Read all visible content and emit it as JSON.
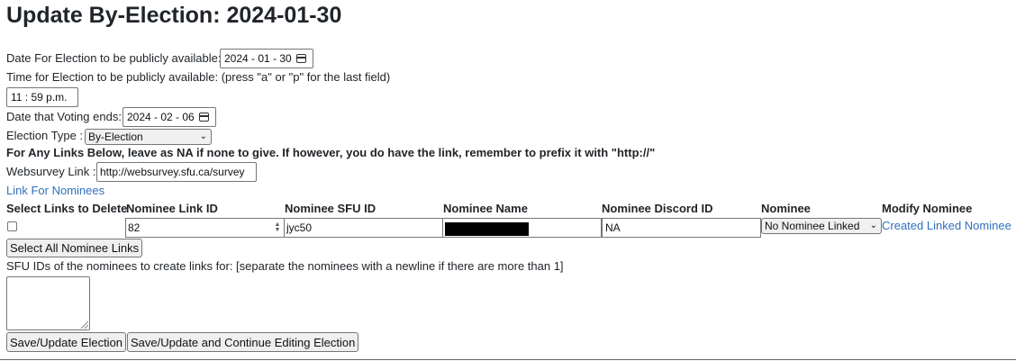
{
  "page_title": "Update By-Election: 2024-01-30",
  "publish_date": {
    "label": "Date For Election to be publicly available:",
    "value": "2024 - 01 - 30"
  },
  "publish_time": {
    "label": "Time for Election to be publicly available: (press \"a\" or \"p\" for the last field)",
    "value": "11 : 59  p.m."
  },
  "voting_end": {
    "label": "Date that Voting ends:",
    "value": "2024 - 02 - 06"
  },
  "election_type": {
    "label": "Election Type :",
    "value": "By-Election"
  },
  "links_note": "For Any Links Below, leave as NA if none to give. If however, you do have the link, remember to prefix it with \"http://\"",
  "websurvey": {
    "label": "Websurvey Link :",
    "value": "http://websurvey.sfu.ca/survey"
  },
  "nominee_link_text": "Link For Nominees",
  "table": {
    "headers": [
      "Select Links to Delete",
      "Nominee Link ID",
      "Nominee SFU ID",
      "Nominee Name",
      "Nominee Discord ID",
      "Nominee",
      "Modify Nominee"
    ],
    "rows": [
      {
        "link_id": "82",
        "sfu_id": "jyc50",
        "discord_id": "NA",
        "nominee": "No Nominee Linked",
        "modify": "Created Linked Nominee"
      }
    ]
  },
  "select_all_button": "Select All Nominee Links",
  "sfu_ids_label": "SFU IDs of the nominees to create links for: [separate the nominees with a newline if there are more than 1]",
  "save_button": "Save/Update Election",
  "save_continue_button": "Save/Update and Continue Editing Election"
}
